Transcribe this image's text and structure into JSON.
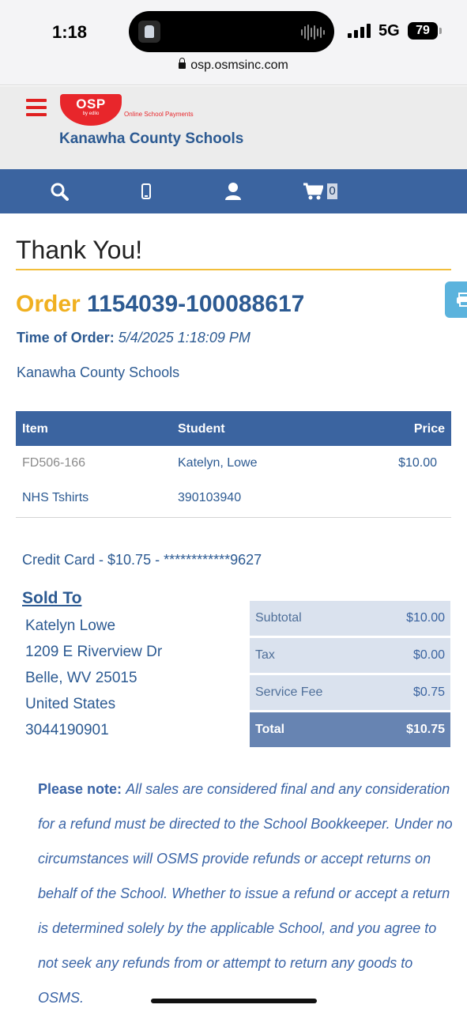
{
  "status_bar": {
    "time": "1:18",
    "network": "5G",
    "battery": "79",
    "url": "osp.osmsinc.com"
  },
  "header": {
    "logo_text": "OSP",
    "logo_sub": "by edlio",
    "tagline": "Online School Payments",
    "district": "Kanawha County Schools"
  },
  "nav": {
    "icons": [
      "search-icon",
      "mobile-icon",
      "user-icon",
      "cart-icon"
    ],
    "cart_count": "0"
  },
  "page": {
    "heading": "Thank You!",
    "order_word": "Order",
    "order_number": "1154039-100088617",
    "time_label": "Time of Order:",
    "time_value": "5/4/2025 1:18:09 PM",
    "school": "Kanawha County Schools"
  },
  "items_table": {
    "columns": [
      "Item",
      "Student",
      "Price"
    ],
    "rows": [
      {
        "item": "FD506-166",
        "student": "Katelyn, Lowe",
        "price": "$10.00"
      },
      {
        "item": "NHS Tshirts",
        "student": "390103940",
        "price": ""
      }
    ]
  },
  "payment": {
    "line": "Credit Card - $10.75 - ************9627"
  },
  "sold_to": {
    "title": "Sold To",
    "name": "Katelyn Lowe",
    "street": "1209 E Riverview Dr",
    "city": "Belle, WV 25015",
    "country": "United States",
    "phone": "3044190901"
  },
  "totals": [
    {
      "label": "Subtotal",
      "value": "$10.00"
    },
    {
      "label": "Tax",
      "value": "$0.00"
    },
    {
      "label": "Service Fee",
      "value": "$0.75"
    },
    {
      "label": "Total",
      "value": "$10.75"
    }
  ],
  "note": {
    "label": "Please note:",
    "text": "All sales are considered final and any consideration for a refund must be directed to the School Bookkeeper. Under no circumstances will OSMS provide refunds or accept returns on behalf of the School. Whether to issue a refund or accept a return is determined solely by the applicable School, and you agree to not seek any refunds from or attempt to return any goods to OSMS."
  },
  "colors": {
    "brand_blue": "#3b64a0",
    "text_blue": "#2c5a92",
    "accent_gold": "#f0b020",
    "logo_red": "#e8262b"
  }
}
